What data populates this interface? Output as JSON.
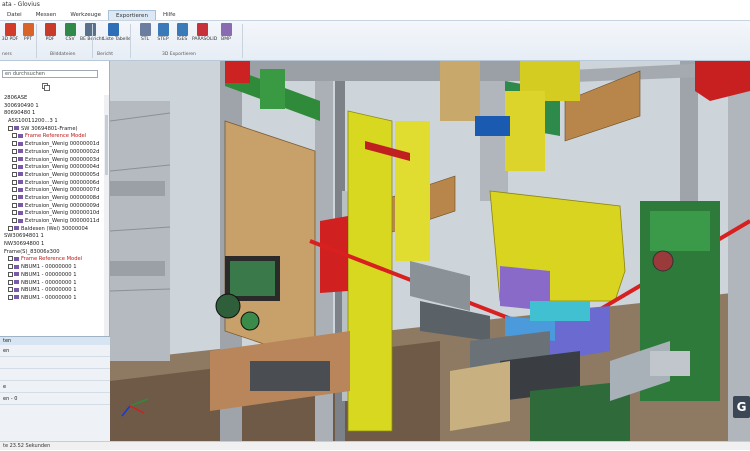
{
  "window": {
    "title": "ata - Glovius"
  },
  "menu": {
    "tabs": [
      {
        "label": "Datei"
      },
      {
        "label": "Messen"
      },
      {
        "label": "Werkzeuge"
      },
      {
        "label": "Exportieren"
      },
      {
        "label": "Hilfe"
      }
    ],
    "active": 3
  },
  "ribbon": {
    "buttons": [
      {
        "label": "3D PDF",
        "color": "#d23a2a"
      },
      {
        "label": "PPT",
        "color": "#d8642a"
      },
      {
        "label": "PDF",
        "color": "#c83a2a"
      },
      {
        "label": "CSV",
        "color": "#2f8a4a"
      },
      {
        "label": "BE Bericht",
        "color": "#5a6f8a"
      },
      {
        "label": "Liste Tabelle",
        "color": "#2f6fb8"
      },
      {
        "label": "STL",
        "color": "#6c7ea0"
      },
      {
        "label": "STEP",
        "color": "#3a7ab8"
      },
      {
        "label": "IGES",
        "color": "#3a7ab8"
      },
      {
        "label": "PARASOLID",
        "color": "#c8303a"
      },
      {
        "label": "BMP",
        "color": "#8a6ab0"
      }
    ],
    "groups": [
      {
        "label": "ners"
      },
      {
        "label": "Bilddateien"
      },
      {
        "label": "Bericht"
      },
      {
        "label": "3D Exportieren"
      }
    ]
  },
  "left_panel": {
    "search_placeholder": "en durchsuchen",
    "tree": [
      {
        "text": "2806ASE",
        "red": false,
        "indent": 1,
        "check": false
      },
      {
        "text": "300690490 1",
        "red": false,
        "indent": 1,
        "check": false
      },
      {
        "text": "80690480 1",
        "red": false,
        "indent": 1,
        "check": false
      },
      {
        "text": "ASS10011200...3 1",
        "red": false,
        "indent": 2,
        "check": false
      },
      {
        "text": "SW 30694801-Frame)",
        "red": false,
        "indent": 2,
        "check": true
      },
      {
        "text": "Frame Reference Model",
        "red": true,
        "indent": 3,
        "check": true
      },
      {
        "text": "Extrusion_Wenig 00000001d",
        "red": false,
        "indent": 3,
        "check": true
      },
      {
        "text": "Extrusion_Wenig 00000002d",
        "red": false,
        "indent": 3,
        "check": true
      },
      {
        "text": "Extrusion_Wenig 00000003d",
        "red": false,
        "indent": 3,
        "check": true
      },
      {
        "text": "Extrusion_Wenig 00000004d",
        "red": false,
        "indent": 3,
        "check": true
      },
      {
        "text": "Extrusion_Wenig 00000005d",
        "red": false,
        "indent": 3,
        "check": true
      },
      {
        "text": "Extrusion_Wenig 00000006d",
        "red": false,
        "indent": 3,
        "check": true
      },
      {
        "text": "Extrusion_Wenig 00000007d",
        "red": false,
        "indent": 3,
        "check": true
      },
      {
        "text": "Extrusion_Wenig 00000008d",
        "red": false,
        "indent": 3,
        "check": true
      },
      {
        "text": "Extrusion_Wenig 00000009d",
        "red": false,
        "indent": 3,
        "check": true
      },
      {
        "text": "Extrusion_Wenig 00000010d",
        "red": false,
        "indent": 3,
        "check": true
      },
      {
        "text": "Extrusion_Wenig 00000011d",
        "red": false,
        "indent": 3,
        "check": true
      },
      {
        "text": "Baldesen (Wel) 30000004",
        "red": false,
        "indent": 2,
        "check": true
      },
      {
        "text": "SW30694801 1",
        "red": false,
        "indent": 1,
        "check": false
      },
      {
        "text": "NW30694800 1",
        "red": false,
        "indent": 1,
        "check": false
      },
      {
        "text": "Frame(S)_83006x300",
        "red": false,
        "indent": 1,
        "check": false
      },
      {
        "text": "Frame Reference Model",
        "red": true,
        "indent": 2,
        "check": true
      },
      {
        "text": "NBUM1 - 00000000 1",
        "red": false,
        "indent": 2,
        "check": true
      },
      {
        "text": "NBUM1 - 00000000 1",
        "red": false,
        "indent": 2,
        "check": true
      },
      {
        "text": "NBUM1 - 00000000 1",
        "red": false,
        "indent": 2,
        "check": true
      },
      {
        "text": "NBUM1 - 00000000 1",
        "red": false,
        "indent": 2,
        "check": true
      },
      {
        "text": "NBUM1 - 00000000 1",
        "red": false,
        "indent": 2,
        "check": true
      }
    ]
  },
  "properties": {
    "tab": "ten",
    "rows": [
      {
        "label": "en"
      },
      {
        "label": ""
      },
      {
        "label": ""
      },
      {
        "label": "e"
      },
      {
        "label": "en - 0"
      }
    ]
  },
  "status": {
    "text": "te 23.52 Sekunden"
  },
  "viewport": {
    "badge": "G"
  }
}
